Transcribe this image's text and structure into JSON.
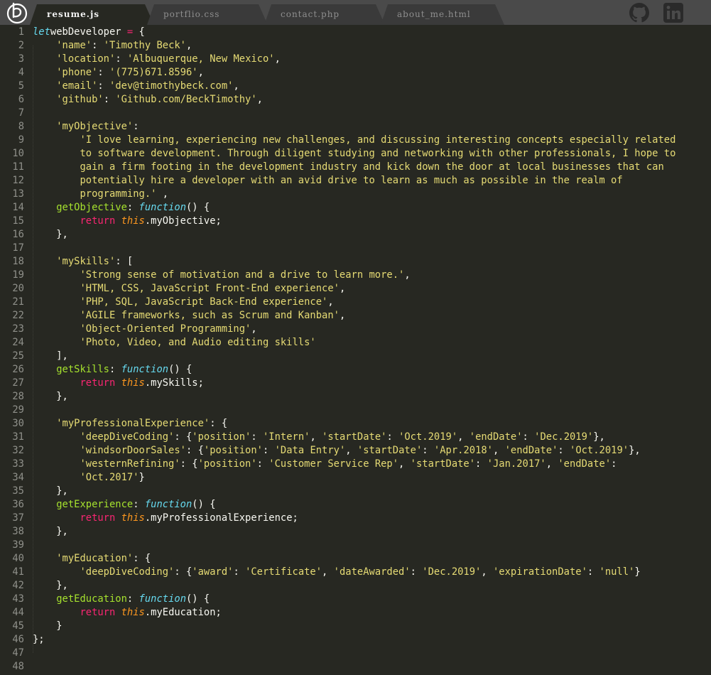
{
  "tabs": [
    {
      "label": "resume.js",
      "active": true
    },
    {
      "label": "portflio.css",
      "active": false
    },
    {
      "label": "contact.php",
      "active": false
    },
    {
      "label": "about_me.html",
      "active": false
    }
  ],
  "social": [
    "github-icon",
    "linkedin-icon"
  ],
  "colors": {
    "background": "#272822",
    "tabbar": "#4a4a4a",
    "active_tab": "#272822",
    "inactive_tab": "#3a3a3a",
    "keyword": "#f92672",
    "declaration": "#66d9ef",
    "this": "#fd971f",
    "string": "#e6db74",
    "function_name": "#a6e22e",
    "text": "#f8f8f2",
    "line_number": "#8f908a"
  },
  "lines": [
    [
      [
        "dec",
        "let"
      ],
      [
        "",
        "webDeveloper "
      ],
      [
        "kw",
        "="
      ],
      [
        "",
        " {"
      ]
    ],
    [
      [
        "",
        "    "
      ],
      [
        "str",
        "'name'"
      ],
      [
        "",
        ": "
      ],
      [
        "str",
        "'Timothy Beck'"
      ],
      [
        "",
        ","
      ]
    ],
    [
      [
        "",
        "    "
      ],
      [
        "str",
        "'location'"
      ],
      [
        "",
        ": "
      ],
      [
        "str",
        "'Albuquerque, New Mexico'"
      ],
      [
        "",
        ","
      ]
    ],
    [
      [
        "",
        "    "
      ],
      [
        "str",
        "'phone'"
      ],
      [
        "",
        ": "
      ],
      [
        "str",
        "'(775)671.8596'"
      ],
      [
        "",
        ","
      ]
    ],
    [
      [
        "",
        "    "
      ],
      [
        "str",
        "'email'"
      ],
      [
        "",
        ": "
      ],
      [
        "str",
        "'dev@timothybeck.com'"
      ],
      [
        "",
        ","
      ]
    ],
    [
      [
        "",
        "    "
      ],
      [
        "str",
        "'github'"
      ],
      [
        "",
        ": "
      ],
      [
        "str",
        "'Github.com/BeckTimothy'"
      ],
      [
        "",
        ","
      ]
    ],
    [],
    [
      [
        "",
        "    "
      ],
      [
        "str",
        "'myObjective'"
      ],
      [
        "",
        ":"
      ]
    ],
    [
      [
        "",
        "        "
      ],
      [
        "str",
        "'I love learning, experiencing new challenges, and discussing interesting concepts especially related"
      ]
    ],
    [
      [
        "",
        "        "
      ],
      [
        "str",
        "to software development. Through diligent studying and networking with other professionals, I hope to"
      ]
    ],
    [
      [
        "",
        "        "
      ],
      [
        "str",
        "gain a firm footing in the development industry and kick down the door at local businesses that can"
      ]
    ],
    [
      [
        "",
        "        "
      ],
      [
        "str",
        "potentially hire a developer with an avid drive to learn as much as possible in the realm of"
      ]
    ],
    [
      [
        "",
        "        "
      ],
      [
        "str",
        "programming.'"
      ],
      [
        "",
        " ,"
      ]
    ],
    [
      [
        "",
        "    "
      ],
      [
        "prop",
        "getObjective"
      ],
      [
        "",
        ": "
      ],
      [
        "dec",
        "function"
      ],
      [
        "",
        "() {"
      ]
    ],
    [
      [
        "",
        "        "
      ],
      [
        "kw",
        "return"
      ],
      [
        "",
        " "
      ],
      [
        "this",
        "this"
      ],
      [
        "",
        ".myObjective;"
      ]
    ],
    [
      [
        "",
        "    },"
      ]
    ],
    [],
    [
      [
        "",
        "    "
      ],
      [
        "str",
        "'mySkills'"
      ],
      [
        "",
        ": ["
      ]
    ],
    [
      [
        "",
        "        "
      ],
      [
        "str",
        "'Strong sense of motivation and a drive to learn more.'"
      ],
      [
        "",
        ","
      ]
    ],
    [
      [
        "",
        "        "
      ],
      [
        "str",
        "'HTML, CSS, JavaScript Front-End experience'"
      ],
      [
        "",
        ","
      ]
    ],
    [
      [
        "",
        "        "
      ],
      [
        "str",
        "'PHP, SQL, JavaScript Back-End experience'"
      ],
      [
        "",
        ","
      ]
    ],
    [
      [
        "",
        "        "
      ],
      [
        "str",
        "'AGILE frameworks, such as Scrum and Kanban'"
      ],
      [
        "",
        ","
      ]
    ],
    [
      [
        "",
        "        "
      ],
      [
        "str",
        "'Object-Oriented Programming'"
      ],
      [
        "",
        ","
      ]
    ],
    [
      [
        "",
        "        "
      ],
      [
        "str",
        "'Photo, Video, and Audio editing skills'"
      ]
    ],
    [
      [
        "",
        "    ],"
      ]
    ],
    [
      [
        "",
        "    "
      ],
      [
        "prop",
        "getSkills"
      ],
      [
        "",
        ": "
      ],
      [
        "dec",
        "function"
      ],
      [
        "",
        "() {"
      ]
    ],
    [
      [
        "",
        "        "
      ],
      [
        "kw",
        "return"
      ],
      [
        "",
        " "
      ],
      [
        "this",
        "this"
      ],
      [
        "",
        ".mySkills;"
      ]
    ],
    [
      [
        "",
        "    },"
      ]
    ],
    [],
    [
      [
        "",
        "    "
      ],
      [
        "str",
        "'myProfessionalExperience'"
      ],
      [
        "",
        ": {"
      ]
    ],
    [
      [
        "",
        "        "
      ],
      [
        "str",
        "'deepDiveCoding'"
      ],
      [
        "",
        ": {"
      ],
      [
        "str",
        "'position'"
      ],
      [
        "",
        ": "
      ],
      [
        "str",
        "'Intern'"
      ],
      [
        "",
        ", "
      ],
      [
        "str",
        "'startDate'"
      ],
      [
        "",
        ": "
      ],
      [
        "str",
        "'Oct.2019'"
      ],
      [
        "",
        ", "
      ],
      [
        "str",
        "'endDate'"
      ],
      [
        "",
        ": "
      ],
      [
        "str",
        "'Dec.2019'"
      ],
      [
        "",
        "},"
      ]
    ],
    [
      [
        "",
        "        "
      ],
      [
        "str",
        "'windsorDoorSales'"
      ],
      [
        "",
        ": {"
      ],
      [
        "str",
        "'position'"
      ],
      [
        "",
        ": "
      ],
      [
        "str",
        "'Data Entry'"
      ],
      [
        "",
        ", "
      ],
      [
        "str",
        "'startDate'"
      ],
      [
        "",
        ": "
      ],
      [
        "str",
        "'Apr.2018'"
      ],
      [
        "",
        ", "
      ],
      [
        "str",
        "'endDate'"
      ],
      [
        "",
        ": "
      ],
      [
        "str",
        "'Oct.2019'"
      ],
      [
        "",
        "},"
      ]
    ],
    [
      [
        "",
        "        "
      ],
      [
        "str",
        "'westernRefining'"
      ],
      [
        "",
        ": {"
      ],
      [
        "str",
        "'position'"
      ],
      [
        "",
        ": "
      ],
      [
        "str",
        "'Customer Service Rep'"
      ],
      [
        "",
        ", "
      ],
      [
        "str",
        "'startDate'"
      ],
      [
        "",
        ": "
      ],
      [
        "str",
        "'Jan.2017'"
      ],
      [
        "",
        ", "
      ],
      [
        "str",
        "'endDate'"
      ],
      [
        "",
        ":"
      ]
    ],
    [
      [
        "",
        "        "
      ],
      [
        "str",
        "'Oct.2017'"
      ],
      [
        "",
        "}"
      ]
    ],
    [
      [
        "",
        "    },"
      ]
    ],
    [
      [
        "",
        "    "
      ],
      [
        "prop",
        "getExperience"
      ],
      [
        "",
        ": "
      ],
      [
        "dec",
        "function"
      ],
      [
        "",
        "() {"
      ]
    ],
    [
      [
        "",
        "        "
      ],
      [
        "kw",
        "return"
      ],
      [
        "",
        " "
      ],
      [
        "this",
        "this"
      ],
      [
        "",
        ".myProfessionalExperience;"
      ]
    ],
    [
      [
        "",
        "    },"
      ]
    ],
    [],
    [
      [
        "",
        "    "
      ],
      [
        "str",
        "'myEducation'"
      ],
      [
        "",
        ": {"
      ]
    ],
    [
      [
        "",
        "        "
      ],
      [
        "str",
        "'deepDiveCoding'"
      ],
      [
        "",
        ": {"
      ],
      [
        "str",
        "'award'"
      ],
      [
        "",
        ": "
      ],
      [
        "str",
        "'Certificate'"
      ],
      [
        "",
        ", "
      ],
      [
        "str",
        "'dateAwarded'"
      ],
      [
        "",
        ": "
      ],
      [
        "str",
        "'Dec.2019'"
      ],
      [
        "",
        ", "
      ],
      [
        "str",
        "'expirationDate'"
      ],
      [
        "",
        ": "
      ],
      [
        "str",
        "'null'"
      ],
      [
        "",
        "}"
      ]
    ],
    [
      [
        "",
        "    },"
      ]
    ],
    [
      [
        "",
        "    "
      ],
      [
        "prop",
        "getEducation"
      ],
      [
        "",
        ": "
      ],
      [
        "dec",
        "function"
      ],
      [
        "",
        "() {"
      ]
    ],
    [
      [
        "",
        "        "
      ],
      [
        "kw",
        "return"
      ],
      [
        "",
        " "
      ],
      [
        "this",
        "this"
      ],
      [
        "",
        ".myEducation;"
      ]
    ],
    [
      [
        "",
        "    }"
      ]
    ],
    [
      [
        "",
        "};"
      ]
    ],
    [],
    []
  ]
}
